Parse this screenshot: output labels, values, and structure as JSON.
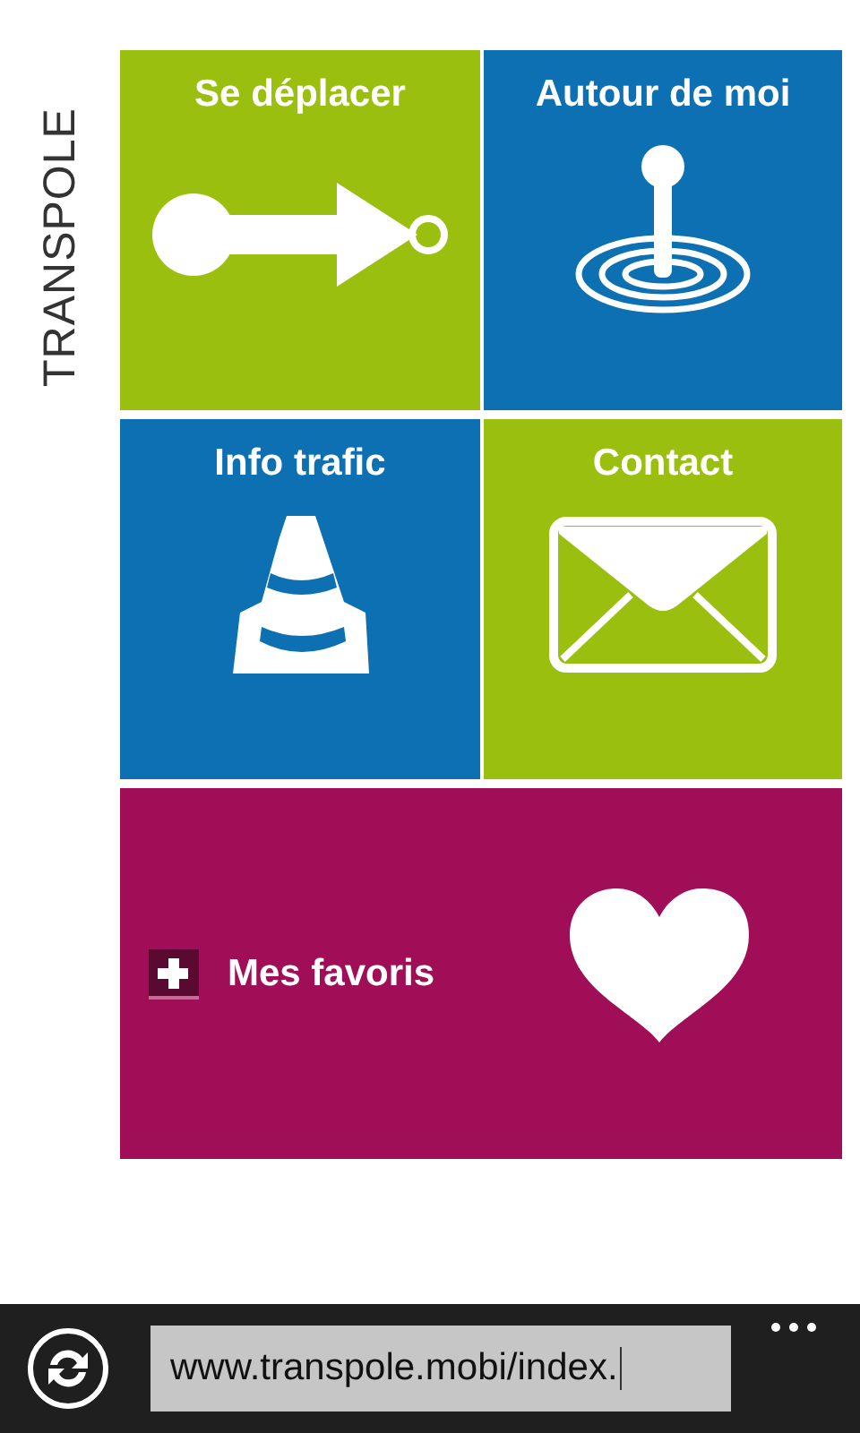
{
  "logo": {
    "text": "TRANSPOLE"
  },
  "tiles": [
    {
      "label": "Se déplacer",
      "kind": "route",
      "color": "#9abf0f"
    },
    {
      "label": "Autour de moi",
      "kind": "nearby",
      "color": "#0c70b3"
    },
    {
      "label": "Info trafic",
      "kind": "traffic",
      "color": "#0c70b3"
    },
    {
      "label": "Contact",
      "kind": "contact",
      "color": "#9abf0f"
    },
    {
      "label": "Mes favoris",
      "kind": "favorites",
      "color": "#a10e58"
    }
  ],
  "browser_bar": {
    "address": "www.transpole.mobi/index."
  }
}
